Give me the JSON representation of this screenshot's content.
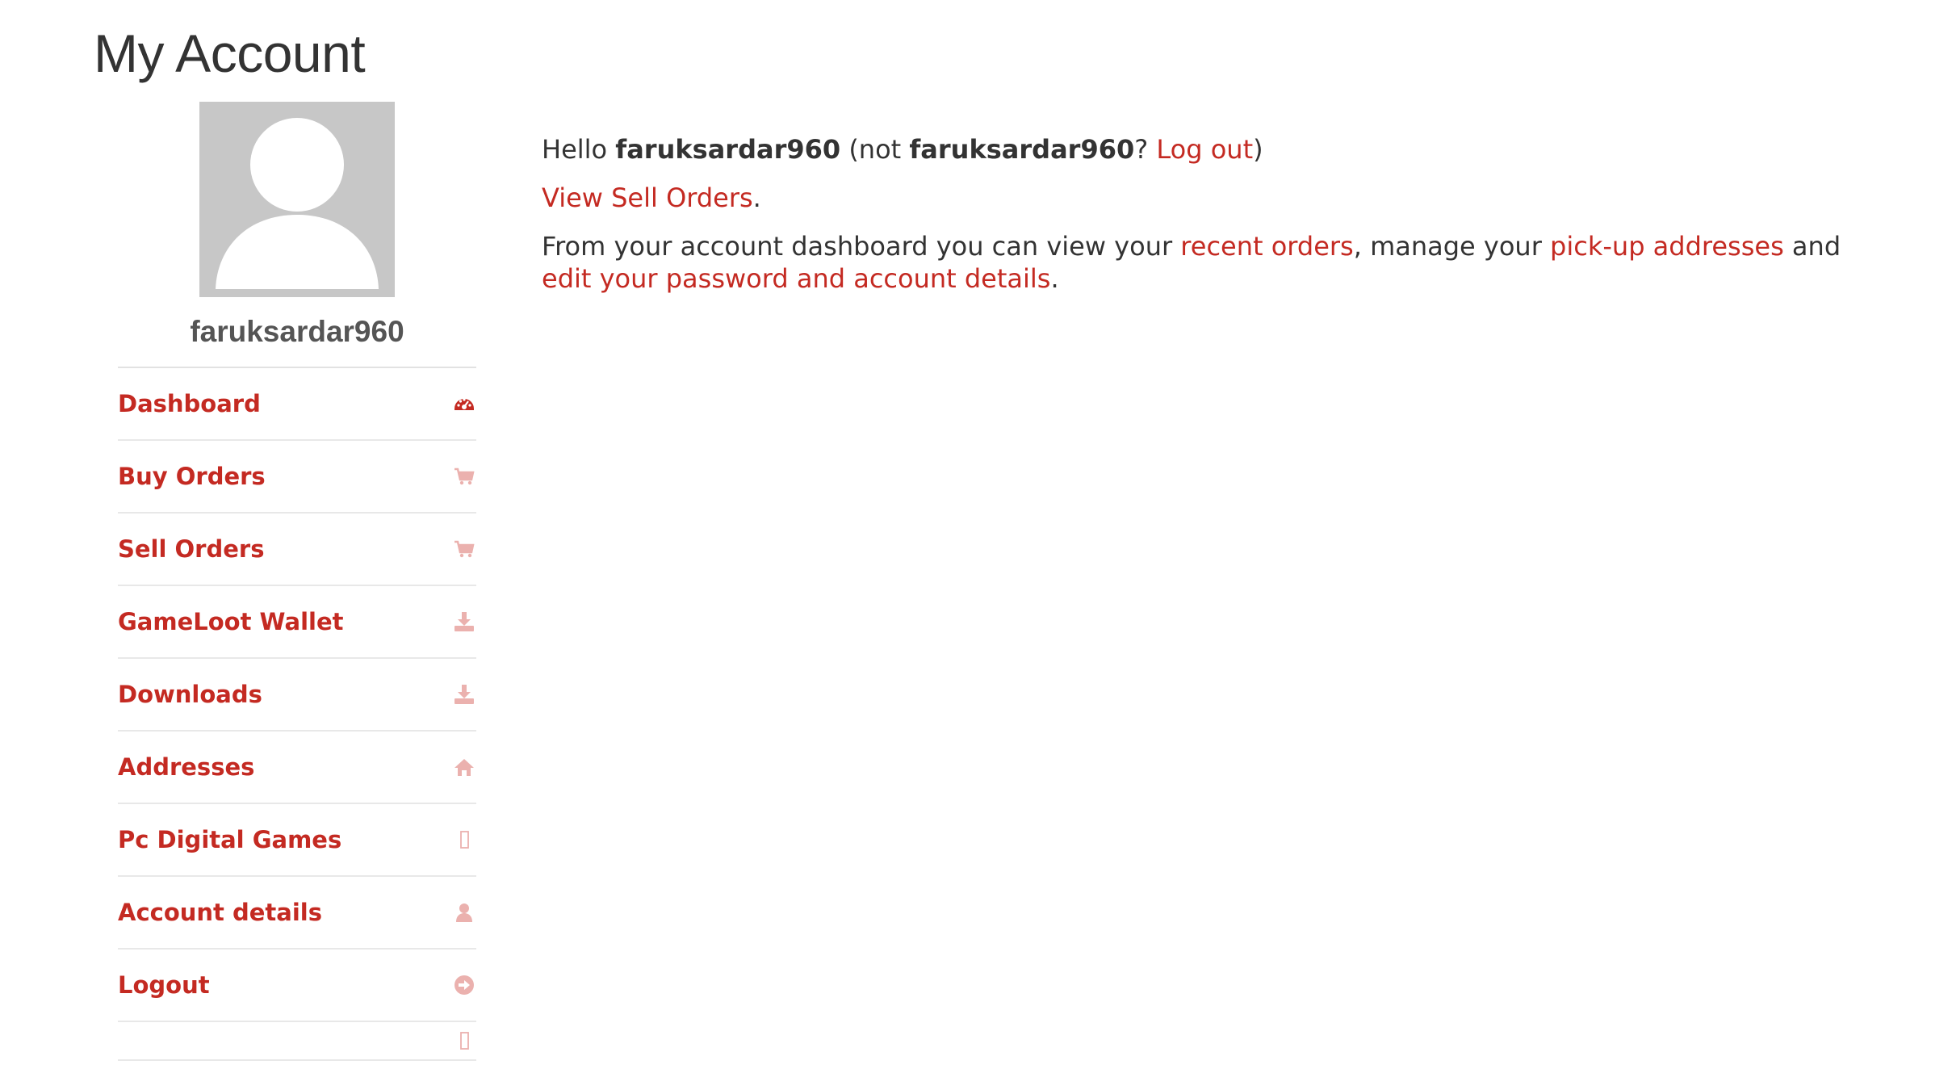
{
  "page": {
    "title": "My Account"
  },
  "profile": {
    "username": "faruksardar960"
  },
  "nav": {
    "items": [
      {
        "label": "Dashboard",
        "icon": "dashboard-icon"
      },
      {
        "label": "Buy Orders",
        "icon": "cart-icon"
      },
      {
        "label": "Sell Orders",
        "icon": "cart-icon"
      },
      {
        "label": "GameLoot Wallet",
        "icon": "download-icon"
      },
      {
        "label": "Downloads",
        "icon": "download-icon"
      },
      {
        "label": "Addresses",
        "icon": "home-icon"
      },
      {
        "label": "Pc Digital Games",
        "icon": "blank-icon"
      },
      {
        "label": "Account details",
        "icon": "user-icon"
      },
      {
        "label": "Logout",
        "icon": "arrow-circle-right-icon"
      }
    ]
  },
  "greeting": {
    "hello": "Hello ",
    "username": "faruksardar960",
    "not_open": " (not ",
    "username_again": "faruksardar960",
    "question": "? ",
    "logout_link": "Log out",
    "close": ")"
  },
  "sell_orders": {
    "link": "View Sell Orders",
    "period": "."
  },
  "dashboard_text": {
    "part1": "From your account dashboard you can view your ",
    "recent_orders_link": "recent orders",
    "part2": ", manage your ",
    "addresses_link": "pick-up addresses",
    "part3": " and ",
    "edit_link": "edit your password and account details",
    "part4": "."
  },
  "colors": {
    "accent": "#c42a22",
    "accent_muted": "#ebb1ae",
    "text": "#333333",
    "divider": "#e8e8e8",
    "avatar_bg": "#c7c7c7"
  }
}
